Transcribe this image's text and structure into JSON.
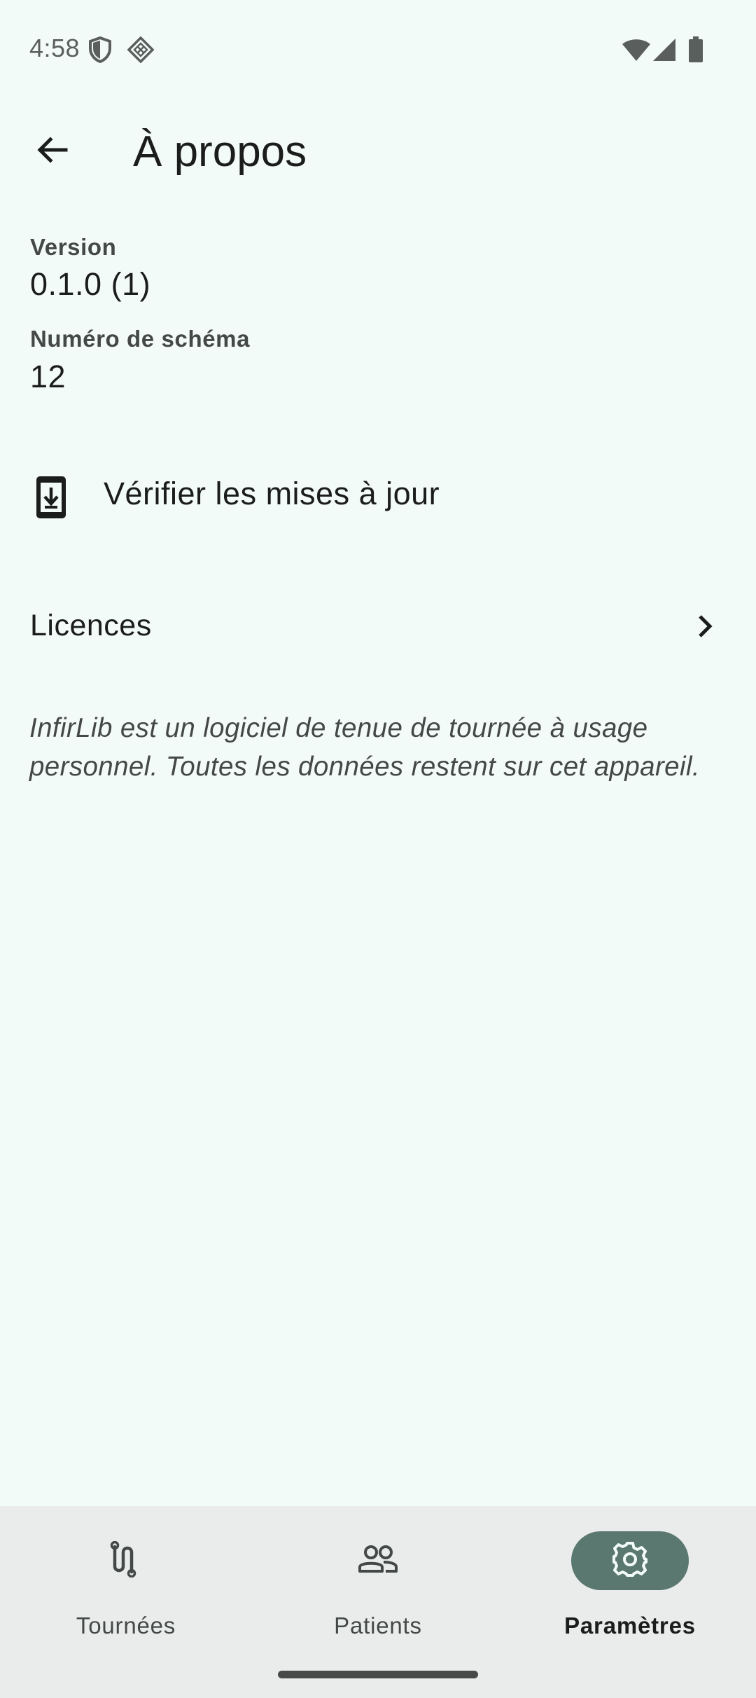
{
  "status_bar": {
    "time": "4:58",
    "icons": [
      "shield-icon",
      "dnd-grid-icon",
      "wifi-icon",
      "cell-signal-icon",
      "battery-icon"
    ]
  },
  "top_bar": {
    "title": "À propos",
    "back_icon": "arrow-back-icon"
  },
  "info": {
    "version_label": "Version",
    "version_value": "0.1.0 (1)",
    "schema_label": "Numéro de schéma",
    "schema_value": "12"
  },
  "actions": {
    "check_updates_label": "Vérifier les mises à jour",
    "check_updates_icon": "system-update-icon",
    "licenses_label": "Licences",
    "licenses_icon": "chevron-right-icon"
  },
  "about_text": "InfirLib est un logiciel de tenue de tournée à usage personnel. Toutes les données restent sur cet appareil.",
  "bottom_nav": {
    "items": [
      {
        "label": "Tournées",
        "icon": "route-icon",
        "active": false
      },
      {
        "label": "Patients",
        "icon": "group-icon",
        "active": false
      },
      {
        "label": "Paramètres",
        "icon": "settings-icon",
        "active": true
      }
    ]
  },
  "colors": {
    "background": "#f3fbf8",
    "nav_background": "#e9ecea",
    "active_pill": "#5a786f",
    "text_primary": "#1b1d1c",
    "text_secondary": "#444846"
  }
}
